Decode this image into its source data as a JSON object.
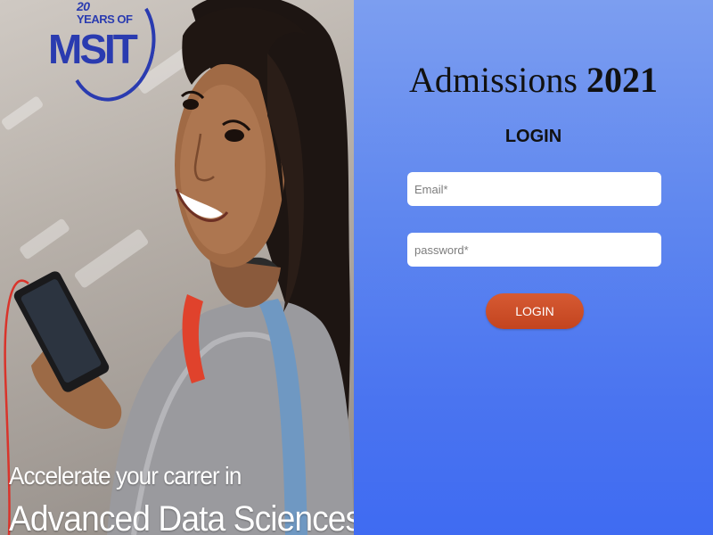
{
  "logo": {
    "years_number": "20",
    "years_text": "YEARS OF",
    "brand": "MSIT"
  },
  "hero": {
    "tagline_line1": "Accelerate your carrer in",
    "tagline_line2": "Advanced Data Sciences"
  },
  "form": {
    "title_text": "Admissions ",
    "title_year": "2021",
    "heading": "LOGIN",
    "email_placeholder": "Email*",
    "email_value": "",
    "password_placeholder": "password*",
    "password_value": "",
    "submit_label": "LOGIN"
  },
  "colors": {
    "brand_blue": "#2a3bb0",
    "panel_top": "#7c9ef0",
    "panel_bottom": "#3f6bf2",
    "button": "#c94a25"
  }
}
